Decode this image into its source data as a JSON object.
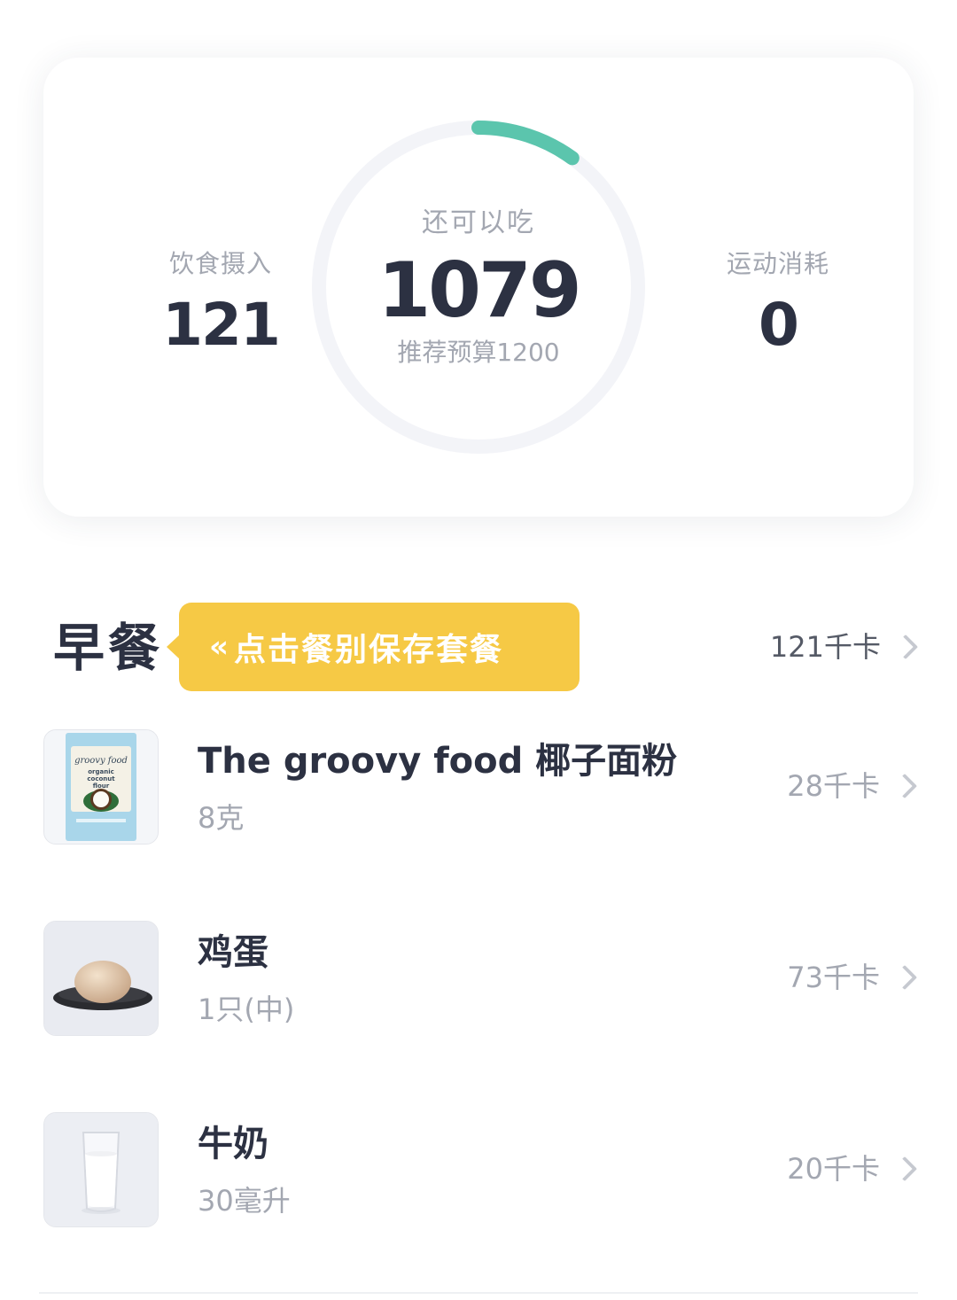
{
  "summary": {
    "intake_label": "饮食摄入",
    "intake_value": "121",
    "remaining_label": "还可以吃",
    "remaining_value": "1079",
    "budget_text": "推荐预算1200",
    "exercise_label": "运动消耗",
    "exercise_value": "0",
    "progress_fraction": 0.1,
    "ring_color": "#5bc5ad",
    "ring_track_color": "#f3f4f8"
  },
  "meal": {
    "title": "早餐",
    "tooltip_text": "点击餐别保存套餐",
    "tooltip_icon": "double-chevron-left-icon",
    "tooltip_color": "#f6c945",
    "total_kcal": "121千卡"
  },
  "foods": [
    {
      "name": "The groovy food 椰子面粉",
      "amount": "8克",
      "kcal": "28千卡",
      "image": "coconut-flour-package-image"
    },
    {
      "name": "鸡蛋",
      "amount": "1只(中)",
      "kcal": "73千卡",
      "image": "egg-on-plate-image"
    },
    {
      "name": "牛奶",
      "amount": "30毫升",
      "kcal": "20千卡",
      "image": "milk-glass-image"
    }
  ]
}
